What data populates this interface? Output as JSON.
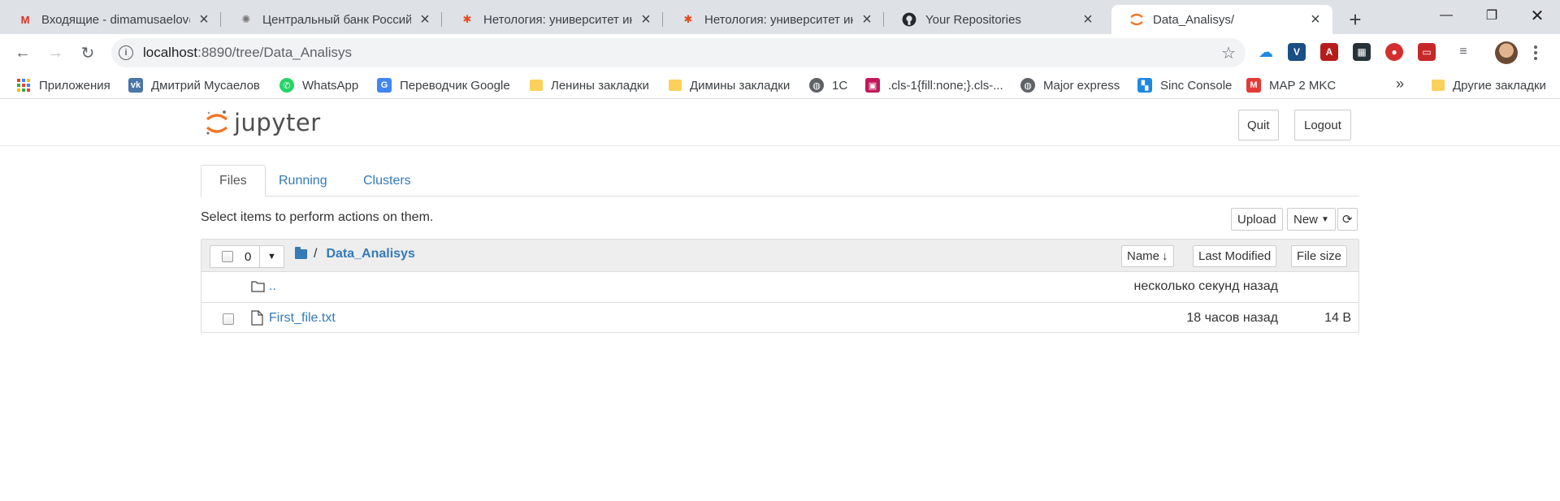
{
  "browser": {
    "tabs": [
      {
        "title": "Входящие - dimamusaelov@gmail.com",
        "icon": "gmail-icon",
        "active": false
      },
      {
        "title": "Центральный банк Российской Федерации",
        "icon": "cbr-icon",
        "active": false
      },
      {
        "title": "Нетология: университет интернет-профессий",
        "icon": "netology-icon",
        "active": false
      },
      {
        "title": "Нетология: университет интернет-профессий",
        "icon": "netology-icon",
        "active": false
      },
      {
        "title": "Your Repositories",
        "icon": "github-icon",
        "active": false
      },
      {
        "title": "Data_Analisys/",
        "icon": "jupyter-icon",
        "active": true
      }
    ],
    "url_host": "localhost",
    "url_rest": ":8890/tree/Data_Analisys",
    "bookmarks": [
      {
        "label": "Приложения",
        "icon": "apps-grid-icon"
      },
      {
        "label": "Дмитрий Мусаелов",
        "icon": "vk-icon"
      },
      {
        "label": "WhatsApp",
        "icon": "whatsapp-icon"
      },
      {
        "label": "Переводчик Google",
        "icon": "google-translate-icon"
      },
      {
        "label": "Ленины закладки",
        "icon": "folder-icon"
      },
      {
        "label": "Димины закладки",
        "icon": "folder-icon"
      },
      {
        "label": "1С",
        "icon": "globe-icon"
      },
      {
        "label": ".cls-1{fill:none;}.cls-...",
        "icon": "image-icon"
      },
      {
        "label": "Major express",
        "icon": "globe-icon"
      },
      {
        "label": "Sinc Console",
        "icon": "sinc-icon"
      },
      {
        "label": "MAP 2 MKC",
        "icon": "map-icon"
      }
    ],
    "bookmarks_more": "»",
    "other_bookmarks": "Другие закладки"
  },
  "jupyter": {
    "logo_text": "jupyter",
    "quit_label": "Quit",
    "logout_label": "Logout",
    "tabs": [
      "Files",
      "Running",
      "Clusters"
    ],
    "hint": "Select items to perform actions on them.",
    "upload_label": "Upload",
    "new_label": "New",
    "selected_count": "0",
    "breadcrumb_sep": "/",
    "breadcrumb_dir": "Data_Analisys",
    "sort_name": "Name",
    "sort_modified": "Last Modified",
    "sort_size": "File size",
    "rows": [
      {
        "name": "..",
        "modified": "несколько секунд назад",
        "size": "",
        "type": "folder"
      },
      {
        "name": "First_file.txt",
        "modified": "18 часов назад",
        "size": "14 B",
        "type": "file"
      }
    ]
  },
  "colors": {
    "link": "#337ab7",
    "jupyter_orange": "#f37626",
    "tabstrip": "#dee1e6"
  }
}
